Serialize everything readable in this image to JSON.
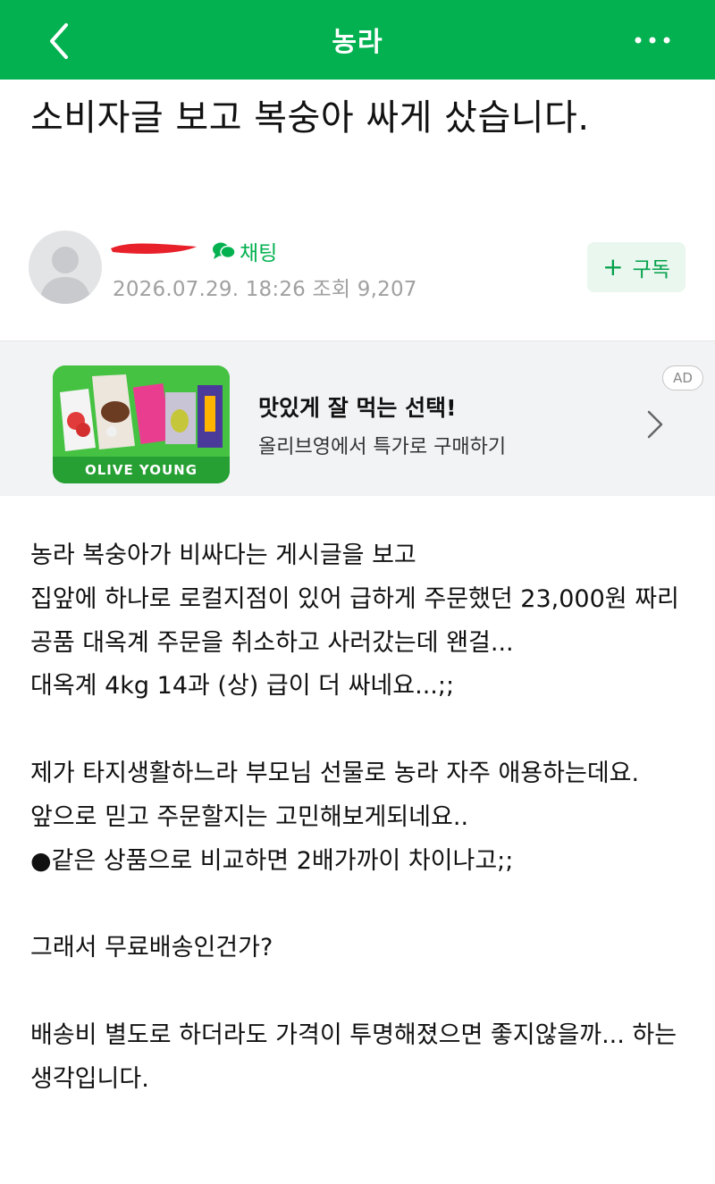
{
  "topbar": {
    "title": "농라",
    "back_icon": "chevron-left-icon",
    "more_icon": "more-horizontal-icon",
    "color": "#03b150"
  },
  "post": {
    "title": "소비자글 보고 복숭아 싸게 샀습니다.",
    "author_name": "",
    "chat_label": "채팅",
    "date": "2026.07.29. 18:26",
    "views_label": "조회",
    "views": "9,207",
    "subscribe_label": "구독"
  },
  "ad": {
    "badge": "AD",
    "headline": "맛있게 잘 먹는 선택!",
    "subtext": "올리브영에서 특가로 구매하기",
    "brand": "OLIVE YOUNG"
  },
  "body_lines": [
    "농라 복숭아가 비싸다는 게시글을 보고",
    "집앞에 하나로 로컬지점이 있어 급하게 주문했던 23,000원 짜리 공품 대옥계 주문을 취소하고 사러갔는데 왠걸...",
    "대옥계 4kg 14과 (상) 급이 더 싸네요...;;",
    "",
    "제가 타지생활하느라 부모님 선물로 농라 자주 애용하는데요.",
    "앞으로 믿고 주문할지는 고민해보게되네요..",
    " ●같은 상품으로 비교하면 2배가까이 차이나고;;",
    "",
    "그래서 무료배송인건가?",
    "",
    "배송비 별도로 하더라도 가격이 투명해졌으면 좋지않을까... 하는 생각입니다."
  ]
}
